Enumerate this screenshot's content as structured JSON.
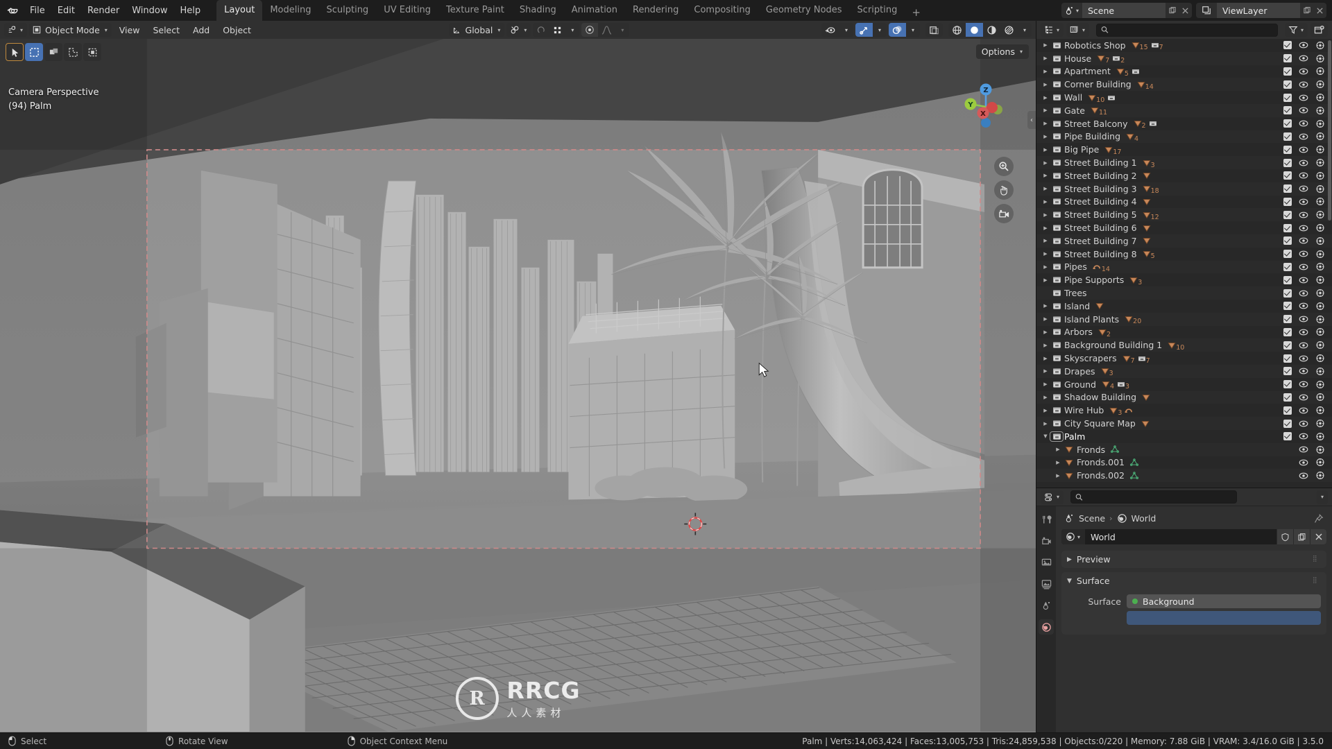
{
  "app": {
    "title": "Blender",
    "version": "3.5.0"
  },
  "topbar": {
    "menus": [
      "File",
      "Edit",
      "Render",
      "Window",
      "Help"
    ],
    "workspaces": [
      {
        "label": "Layout",
        "active": true
      },
      {
        "label": "Modeling",
        "active": false
      },
      {
        "label": "Sculpting",
        "active": false
      },
      {
        "label": "UV Editing",
        "active": false
      },
      {
        "label": "Texture Paint",
        "active": false
      },
      {
        "label": "Shading",
        "active": false
      },
      {
        "label": "Animation",
        "active": false
      },
      {
        "label": "Rendering",
        "active": false
      },
      {
        "label": "Compositing",
        "active": false
      },
      {
        "label": "Geometry Nodes",
        "active": false
      },
      {
        "label": "Scripting",
        "active": false
      }
    ],
    "add_workspace": "+",
    "scene_name": "Scene",
    "viewlayer_name": "ViewLayer"
  },
  "viewport_header": {
    "mode": "Object Mode",
    "menus": [
      "View",
      "Select",
      "Add",
      "Object"
    ],
    "transform_orientation": "Global",
    "options_label": "Options"
  },
  "viewport": {
    "view_name": "Camera Perspective",
    "active_object": "(94) Palm",
    "gizmo_axes": [
      "X",
      "Y",
      "Z"
    ]
  },
  "outliner": {
    "search_placeholder": "",
    "search_value": "",
    "items": [
      {
        "name": "Robotics Shop",
        "indent": 0,
        "expandable": true,
        "expanded": false,
        "type": "collection",
        "counts": [
          {
            "icon": "mesh",
            "n": "15"
          },
          {
            "icon": "collection",
            "n": "7"
          }
        ],
        "checkbox": true
      },
      {
        "name": "House",
        "indent": 0,
        "expandable": true,
        "expanded": false,
        "type": "collection",
        "counts": [
          {
            "icon": "mesh",
            "n": "7"
          },
          {
            "icon": "collection",
            "n": "2"
          }
        ],
        "checkbox": true
      },
      {
        "name": "Apartment",
        "indent": 0,
        "expandable": true,
        "expanded": false,
        "type": "collection",
        "counts": [
          {
            "icon": "mesh",
            "n": "5"
          },
          {
            "icon": "collection",
            "n": ""
          }
        ],
        "checkbox": true
      },
      {
        "name": "Corner Building",
        "indent": 0,
        "expandable": true,
        "expanded": false,
        "type": "collection",
        "counts": [
          {
            "icon": "mesh",
            "n": "14"
          }
        ],
        "checkbox": true
      },
      {
        "name": "Wall",
        "indent": 0,
        "expandable": true,
        "expanded": false,
        "type": "collection",
        "counts": [
          {
            "icon": "mesh",
            "n": "10"
          },
          {
            "icon": "collection",
            "n": ""
          }
        ],
        "checkbox": true
      },
      {
        "name": "Gate",
        "indent": 0,
        "expandable": true,
        "expanded": false,
        "type": "collection",
        "counts": [
          {
            "icon": "mesh",
            "n": "11"
          }
        ],
        "checkbox": true
      },
      {
        "name": "Street Balcony",
        "indent": 0,
        "expandable": true,
        "expanded": false,
        "type": "collection",
        "counts": [
          {
            "icon": "mesh",
            "n": "2"
          },
          {
            "icon": "collection",
            "n": ""
          }
        ],
        "checkbox": true
      },
      {
        "name": "Pipe Building",
        "indent": 0,
        "expandable": true,
        "expanded": false,
        "type": "collection",
        "counts": [
          {
            "icon": "mesh",
            "n": "4"
          }
        ],
        "checkbox": true
      },
      {
        "name": "Big Pipe",
        "indent": 0,
        "expandable": true,
        "expanded": false,
        "type": "collection",
        "counts": [
          {
            "icon": "mesh",
            "n": "17"
          }
        ],
        "checkbox": true
      },
      {
        "name": "Street Building 1",
        "indent": 0,
        "expandable": true,
        "expanded": false,
        "type": "collection",
        "counts": [
          {
            "icon": "mesh",
            "n": "3"
          }
        ],
        "checkbox": true
      },
      {
        "name": "Street Building 2",
        "indent": 0,
        "expandable": true,
        "expanded": false,
        "type": "collection",
        "counts": [
          {
            "icon": "mesh",
            "n": ""
          }
        ],
        "checkbox": true
      },
      {
        "name": "Street Building 3",
        "indent": 0,
        "expandable": true,
        "expanded": false,
        "type": "collection",
        "counts": [
          {
            "icon": "mesh",
            "n": "18"
          }
        ],
        "checkbox": true
      },
      {
        "name": "Street Building 4",
        "indent": 0,
        "expandable": true,
        "expanded": false,
        "type": "collection",
        "counts": [
          {
            "icon": "mesh",
            "n": ""
          }
        ],
        "checkbox": true
      },
      {
        "name": "Street Building 5",
        "indent": 0,
        "expandable": true,
        "expanded": false,
        "type": "collection",
        "counts": [
          {
            "icon": "mesh",
            "n": "12"
          }
        ],
        "checkbox": true
      },
      {
        "name": "Street Building 6",
        "indent": 0,
        "expandable": true,
        "expanded": false,
        "type": "collection",
        "counts": [
          {
            "icon": "mesh",
            "n": ""
          }
        ],
        "checkbox": true
      },
      {
        "name": "Street Building 7",
        "indent": 0,
        "expandable": true,
        "expanded": false,
        "type": "collection",
        "counts": [
          {
            "icon": "mesh",
            "n": ""
          }
        ],
        "checkbox": true
      },
      {
        "name": "Street Building 8",
        "indent": 0,
        "expandable": true,
        "expanded": false,
        "type": "collection",
        "counts": [
          {
            "icon": "mesh",
            "n": "5"
          }
        ],
        "checkbox": true
      },
      {
        "name": "Pipes",
        "indent": 0,
        "expandable": true,
        "expanded": false,
        "type": "collection",
        "counts": [
          {
            "icon": "curve",
            "n": "14"
          }
        ],
        "checkbox": true
      },
      {
        "name": "Pipe Supports",
        "indent": 0,
        "expandable": true,
        "expanded": false,
        "type": "collection",
        "counts": [
          {
            "icon": "mesh",
            "n": "3"
          }
        ],
        "checkbox": true
      },
      {
        "name": "Trees",
        "indent": 0,
        "expandable": false,
        "expanded": false,
        "type": "collection",
        "counts": [],
        "checkbox": true
      },
      {
        "name": "Island",
        "indent": 0,
        "expandable": true,
        "expanded": false,
        "type": "collection",
        "counts": [
          {
            "icon": "mesh",
            "n": ""
          }
        ],
        "checkbox": true
      },
      {
        "name": "Island Plants",
        "indent": 0,
        "expandable": true,
        "expanded": false,
        "type": "collection",
        "counts": [
          {
            "icon": "mesh",
            "n": "20"
          }
        ],
        "checkbox": true
      },
      {
        "name": "Arbors",
        "indent": 0,
        "expandable": true,
        "expanded": false,
        "type": "collection",
        "counts": [
          {
            "icon": "mesh",
            "n": "2"
          }
        ],
        "checkbox": true
      },
      {
        "name": "Background Building 1",
        "indent": 0,
        "expandable": true,
        "expanded": false,
        "type": "collection",
        "counts": [
          {
            "icon": "mesh",
            "n": "10"
          }
        ],
        "checkbox": true
      },
      {
        "name": "Skyscrapers",
        "indent": 0,
        "expandable": true,
        "expanded": false,
        "type": "collection",
        "counts": [
          {
            "icon": "mesh",
            "n": "7"
          },
          {
            "icon": "collection",
            "n": "7"
          }
        ],
        "checkbox": true
      },
      {
        "name": "Drapes",
        "indent": 0,
        "expandable": true,
        "expanded": false,
        "type": "collection",
        "counts": [
          {
            "icon": "mesh",
            "n": "3"
          }
        ],
        "checkbox": true
      },
      {
        "name": "Ground",
        "indent": 0,
        "expandable": true,
        "expanded": false,
        "type": "collection",
        "counts": [
          {
            "icon": "mesh",
            "n": "4"
          },
          {
            "icon": "collection",
            "n": "3"
          }
        ],
        "checkbox": true
      },
      {
        "name": "Shadow Building",
        "indent": 0,
        "expandable": true,
        "expanded": false,
        "type": "collection",
        "counts": [
          {
            "icon": "mesh",
            "n": ""
          }
        ],
        "checkbox": true
      },
      {
        "name": "Wire Hub",
        "indent": 0,
        "expandable": true,
        "expanded": false,
        "type": "collection",
        "counts": [
          {
            "icon": "mesh",
            "n": "3"
          },
          {
            "icon": "curve",
            "n": ""
          }
        ],
        "checkbox": true
      },
      {
        "name": "City Square Map",
        "indent": 0,
        "expandable": true,
        "expanded": false,
        "type": "collection",
        "counts": [
          {
            "icon": "mesh",
            "n": ""
          }
        ],
        "checkbox": true
      },
      {
        "name": "Palm",
        "indent": 0,
        "expandable": true,
        "expanded": true,
        "type": "collection",
        "selected": true,
        "counts": [],
        "checkbox": true
      },
      {
        "name": "Fronds",
        "indent": 1,
        "expandable": true,
        "expanded": false,
        "type": "mesh-object",
        "counts": [
          {
            "icon": "meshdata",
            "n": ""
          }
        ],
        "checkbox": false
      },
      {
        "name": "Fronds.001",
        "indent": 1,
        "expandable": true,
        "expanded": false,
        "type": "mesh-object",
        "counts": [
          {
            "icon": "meshdata",
            "n": ""
          }
        ],
        "checkbox": false
      },
      {
        "name": "Fronds.002",
        "indent": 1,
        "expandable": true,
        "expanded": false,
        "type": "mesh-object",
        "counts": [
          {
            "icon": "meshdata",
            "n": ""
          }
        ],
        "checkbox": false
      }
    ]
  },
  "properties": {
    "search_value": "",
    "breadcrumb": [
      "Scene",
      "World"
    ],
    "world_name": "World",
    "panels": [
      {
        "label": "Preview",
        "open": false
      },
      {
        "label": "Surface",
        "open": true
      }
    ],
    "surface_field_label": "Surface",
    "surface_field_value": "Background"
  },
  "statusbar": {
    "hints": [
      {
        "icon": "mouse-left",
        "label": "Select"
      },
      {
        "icon": "mouse-middle",
        "label": "Rotate View"
      },
      {
        "icon": "mouse-right",
        "label": "Object Context Menu"
      }
    ],
    "stats": "Palm | Verts:14,063,424 | Faces:13,005,753 | Tris:24,859,538 | Objects:0/220 | Memory: 7.88 GiB | VRAM: 3.4/16.0 GiB | 3.5.0"
  },
  "watermark": {
    "mark": "R",
    "line1": "RRCG",
    "line2": "人人素材"
  },
  "colors": {
    "accent_blue": "#4772b3",
    "collection_orange": "#c8885a",
    "mesh_green": "#4caf78",
    "bg_dark": "#1d1d1d",
    "bg_panel": "#303030",
    "bg_outliner": "#282828"
  }
}
